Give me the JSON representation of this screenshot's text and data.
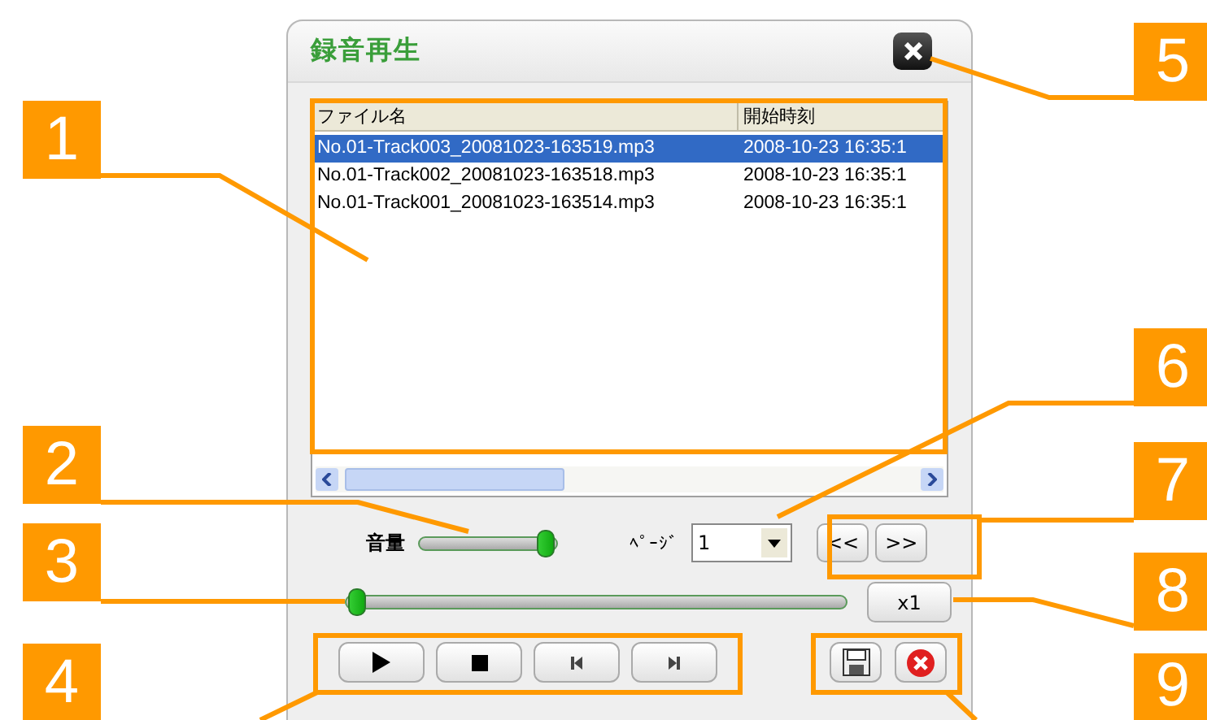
{
  "window": {
    "title": "録音再生"
  },
  "file_list": {
    "columns": [
      "ファイル名",
      "開始時刻"
    ],
    "rows": [
      {
        "name": "No.01-Track003_20081023-163519.mp3",
        "start": "2008-10-23 16:35:1",
        "selected": true
      },
      {
        "name": "No.01-Track002_20081023-163518.mp3",
        "start": "2008-10-23 16:35:1",
        "selected": false
      },
      {
        "name": "No.01-Track001_20081023-163514.mp3",
        "start": "2008-10-23 16:35:1",
        "selected": false
      }
    ]
  },
  "volume": {
    "label": "音量",
    "level": 0.92
  },
  "page": {
    "label": "ﾍﾟｰｼﾞ",
    "value": "1"
  },
  "page_buttons": [
    "<<",
    ">>"
  ],
  "seek": {
    "level": 0
  },
  "speed_button": "x1",
  "transport": [
    {
      "kind": "play"
    },
    {
      "kind": "stop"
    },
    {
      "kind": "previous"
    },
    {
      "kind": "next"
    }
  ],
  "actions": [
    {
      "kind": "save"
    },
    {
      "kind": "cancel"
    }
  ],
  "callouts": [
    "1",
    "2",
    "3",
    "4",
    "5",
    "6",
    "7",
    "8",
    "9"
  ]
}
